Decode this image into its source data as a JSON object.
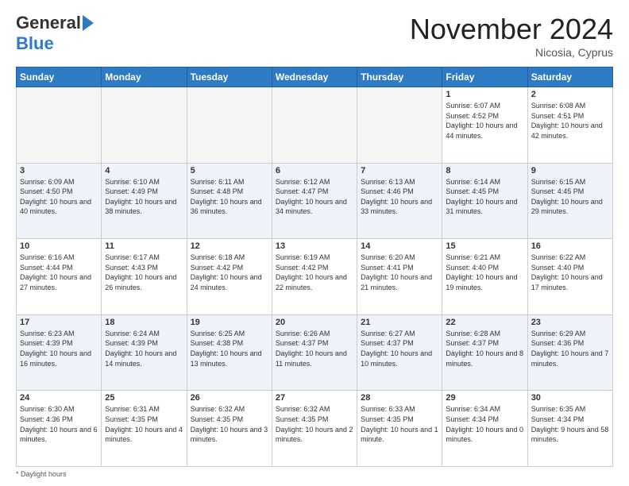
{
  "header": {
    "logo_line1": "General",
    "logo_line2": "Blue",
    "month_title": "November 2024",
    "subtitle": "Nicosia, Cyprus"
  },
  "days_of_week": [
    "Sunday",
    "Monday",
    "Tuesday",
    "Wednesday",
    "Thursday",
    "Friday",
    "Saturday"
  ],
  "weeks": [
    [
      {
        "day": "",
        "sunrise": "",
        "sunset": "",
        "daylight": "",
        "empty": true
      },
      {
        "day": "",
        "sunrise": "",
        "sunset": "",
        "daylight": "",
        "empty": true
      },
      {
        "day": "",
        "sunrise": "",
        "sunset": "",
        "daylight": "",
        "empty": true
      },
      {
        "day": "",
        "sunrise": "",
        "sunset": "",
        "daylight": "",
        "empty": true
      },
      {
        "day": "",
        "sunrise": "",
        "sunset": "",
        "daylight": "",
        "empty": true
      },
      {
        "day": "1",
        "sunrise": "Sunrise: 6:07 AM",
        "sunset": "Sunset: 4:52 PM",
        "daylight": "Daylight: 10 hours and 44 minutes.",
        "empty": false
      },
      {
        "day": "2",
        "sunrise": "Sunrise: 6:08 AM",
        "sunset": "Sunset: 4:51 PM",
        "daylight": "Daylight: 10 hours and 42 minutes.",
        "empty": false
      }
    ],
    [
      {
        "day": "3",
        "sunrise": "Sunrise: 6:09 AM",
        "sunset": "Sunset: 4:50 PM",
        "daylight": "Daylight: 10 hours and 40 minutes.",
        "empty": false
      },
      {
        "day": "4",
        "sunrise": "Sunrise: 6:10 AM",
        "sunset": "Sunset: 4:49 PM",
        "daylight": "Daylight: 10 hours and 38 minutes.",
        "empty": false
      },
      {
        "day": "5",
        "sunrise": "Sunrise: 6:11 AM",
        "sunset": "Sunset: 4:48 PM",
        "daylight": "Daylight: 10 hours and 36 minutes.",
        "empty": false
      },
      {
        "day": "6",
        "sunrise": "Sunrise: 6:12 AM",
        "sunset": "Sunset: 4:47 PM",
        "daylight": "Daylight: 10 hours and 34 minutes.",
        "empty": false
      },
      {
        "day": "7",
        "sunrise": "Sunrise: 6:13 AM",
        "sunset": "Sunset: 4:46 PM",
        "daylight": "Daylight: 10 hours and 33 minutes.",
        "empty": false
      },
      {
        "day": "8",
        "sunrise": "Sunrise: 6:14 AM",
        "sunset": "Sunset: 4:45 PM",
        "daylight": "Daylight: 10 hours and 31 minutes.",
        "empty": false
      },
      {
        "day": "9",
        "sunrise": "Sunrise: 6:15 AM",
        "sunset": "Sunset: 4:45 PM",
        "daylight": "Daylight: 10 hours and 29 minutes.",
        "empty": false
      }
    ],
    [
      {
        "day": "10",
        "sunrise": "Sunrise: 6:16 AM",
        "sunset": "Sunset: 4:44 PM",
        "daylight": "Daylight: 10 hours and 27 minutes.",
        "empty": false
      },
      {
        "day": "11",
        "sunrise": "Sunrise: 6:17 AM",
        "sunset": "Sunset: 4:43 PM",
        "daylight": "Daylight: 10 hours and 26 minutes.",
        "empty": false
      },
      {
        "day": "12",
        "sunrise": "Sunrise: 6:18 AM",
        "sunset": "Sunset: 4:42 PM",
        "daylight": "Daylight: 10 hours and 24 minutes.",
        "empty": false
      },
      {
        "day": "13",
        "sunrise": "Sunrise: 6:19 AM",
        "sunset": "Sunset: 4:42 PM",
        "daylight": "Daylight: 10 hours and 22 minutes.",
        "empty": false
      },
      {
        "day": "14",
        "sunrise": "Sunrise: 6:20 AM",
        "sunset": "Sunset: 4:41 PM",
        "daylight": "Daylight: 10 hours and 21 minutes.",
        "empty": false
      },
      {
        "day": "15",
        "sunrise": "Sunrise: 6:21 AM",
        "sunset": "Sunset: 4:40 PM",
        "daylight": "Daylight: 10 hours and 19 minutes.",
        "empty": false
      },
      {
        "day": "16",
        "sunrise": "Sunrise: 6:22 AM",
        "sunset": "Sunset: 4:40 PM",
        "daylight": "Daylight: 10 hours and 17 minutes.",
        "empty": false
      }
    ],
    [
      {
        "day": "17",
        "sunrise": "Sunrise: 6:23 AM",
        "sunset": "Sunset: 4:39 PM",
        "daylight": "Daylight: 10 hours and 16 minutes.",
        "empty": false
      },
      {
        "day": "18",
        "sunrise": "Sunrise: 6:24 AM",
        "sunset": "Sunset: 4:39 PM",
        "daylight": "Daylight: 10 hours and 14 minutes.",
        "empty": false
      },
      {
        "day": "19",
        "sunrise": "Sunrise: 6:25 AM",
        "sunset": "Sunset: 4:38 PM",
        "daylight": "Daylight: 10 hours and 13 minutes.",
        "empty": false
      },
      {
        "day": "20",
        "sunrise": "Sunrise: 6:26 AM",
        "sunset": "Sunset: 4:37 PM",
        "daylight": "Daylight: 10 hours and 11 minutes.",
        "empty": false
      },
      {
        "day": "21",
        "sunrise": "Sunrise: 6:27 AM",
        "sunset": "Sunset: 4:37 PM",
        "daylight": "Daylight: 10 hours and 10 minutes.",
        "empty": false
      },
      {
        "day": "22",
        "sunrise": "Sunrise: 6:28 AM",
        "sunset": "Sunset: 4:37 PM",
        "daylight": "Daylight: 10 hours and 8 minutes.",
        "empty": false
      },
      {
        "day": "23",
        "sunrise": "Sunrise: 6:29 AM",
        "sunset": "Sunset: 4:36 PM",
        "daylight": "Daylight: 10 hours and 7 minutes.",
        "empty": false
      }
    ],
    [
      {
        "day": "24",
        "sunrise": "Sunrise: 6:30 AM",
        "sunset": "Sunset: 4:36 PM",
        "daylight": "Daylight: 10 hours and 6 minutes.",
        "empty": false
      },
      {
        "day": "25",
        "sunrise": "Sunrise: 6:31 AM",
        "sunset": "Sunset: 4:35 PM",
        "daylight": "Daylight: 10 hours and 4 minutes.",
        "empty": false
      },
      {
        "day": "26",
        "sunrise": "Sunrise: 6:32 AM",
        "sunset": "Sunset: 4:35 PM",
        "daylight": "Daylight: 10 hours and 3 minutes.",
        "empty": false
      },
      {
        "day": "27",
        "sunrise": "Sunrise: 6:32 AM",
        "sunset": "Sunset: 4:35 PM",
        "daylight": "Daylight: 10 hours and 2 minutes.",
        "empty": false
      },
      {
        "day": "28",
        "sunrise": "Sunrise: 6:33 AM",
        "sunset": "Sunset: 4:35 PM",
        "daylight": "Daylight: 10 hours and 1 minute.",
        "empty": false
      },
      {
        "day": "29",
        "sunrise": "Sunrise: 6:34 AM",
        "sunset": "Sunset: 4:34 PM",
        "daylight": "Daylight: 10 hours and 0 minutes.",
        "empty": false
      },
      {
        "day": "30",
        "sunrise": "Sunrise: 6:35 AM",
        "sunset": "Sunset: 4:34 PM",
        "daylight": "Daylight: 9 hours and 58 minutes.",
        "empty": false
      }
    ]
  ],
  "footer": {
    "daylight_label": "Daylight hours"
  }
}
